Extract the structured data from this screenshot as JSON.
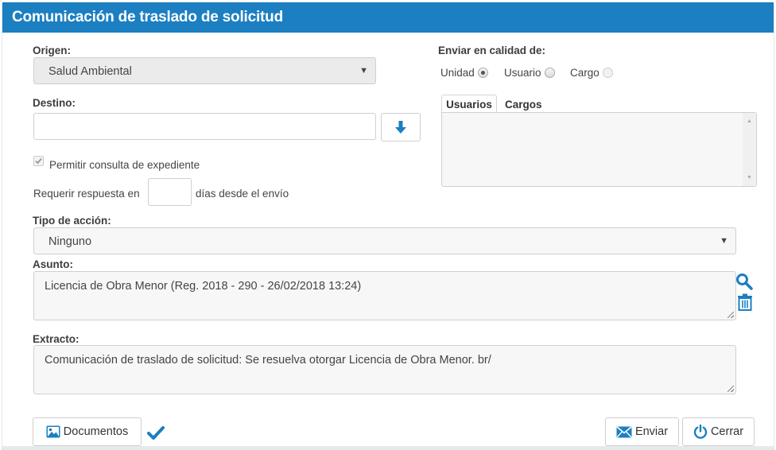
{
  "dialog": {
    "title": "Comunicación de traslado de solicitud"
  },
  "origen": {
    "label": "Origen:",
    "value": "Salud Ambiental"
  },
  "destino": {
    "label": "Destino:",
    "value": ""
  },
  "enviar_calidad": {
    "label": "Enviar en calidad de:",
    "options": [
      "Unidad",
      "Usuario",
      "Cargo"
    ],
    "selected": "Unidad"
  },
  "tabs": [
    "Usuarios",
    "Cargos"
  ],
  "permitir_consulta": {
    "label": "Permitir consulta de expediente",
    "checked": true
  },
  "requerir": {
    "prefix": "Requerir respuesta en",
    "value": "",
    "suffix": "días desde el envío"
  },
  "tipo_accion": {
    "label": "Tipo de acción:",
    "value": "Ninguno"
  },
  "asunto": {
    "label": "Asunto:",
    "value": "Licencia de Obra Menor (Reg. 2018 - 290 - 26/02/2018 13:24)"
  },
  "extracto": {
    "label": "Extracto:",
    "value": "Comunicación de traslado de solicitud: Se resuelva otorgar Licencia de Obra Menor. br/"
  },
  "buttons": {
    "documentos": "Documentos",
    "enviar": "Enviar",
    "cerrar": "Cerrar"
  },
  "icons": {
    "accent": "#1b7fc1",
    "download": "arrow-down-icon",
    "search": "search-icon",
    "trash": "trash-icon",
    "check": "check-icon",
    "image": "image-icon",
    "mail": "envelope-icon",
    "power": "power-icon"
  }
}
